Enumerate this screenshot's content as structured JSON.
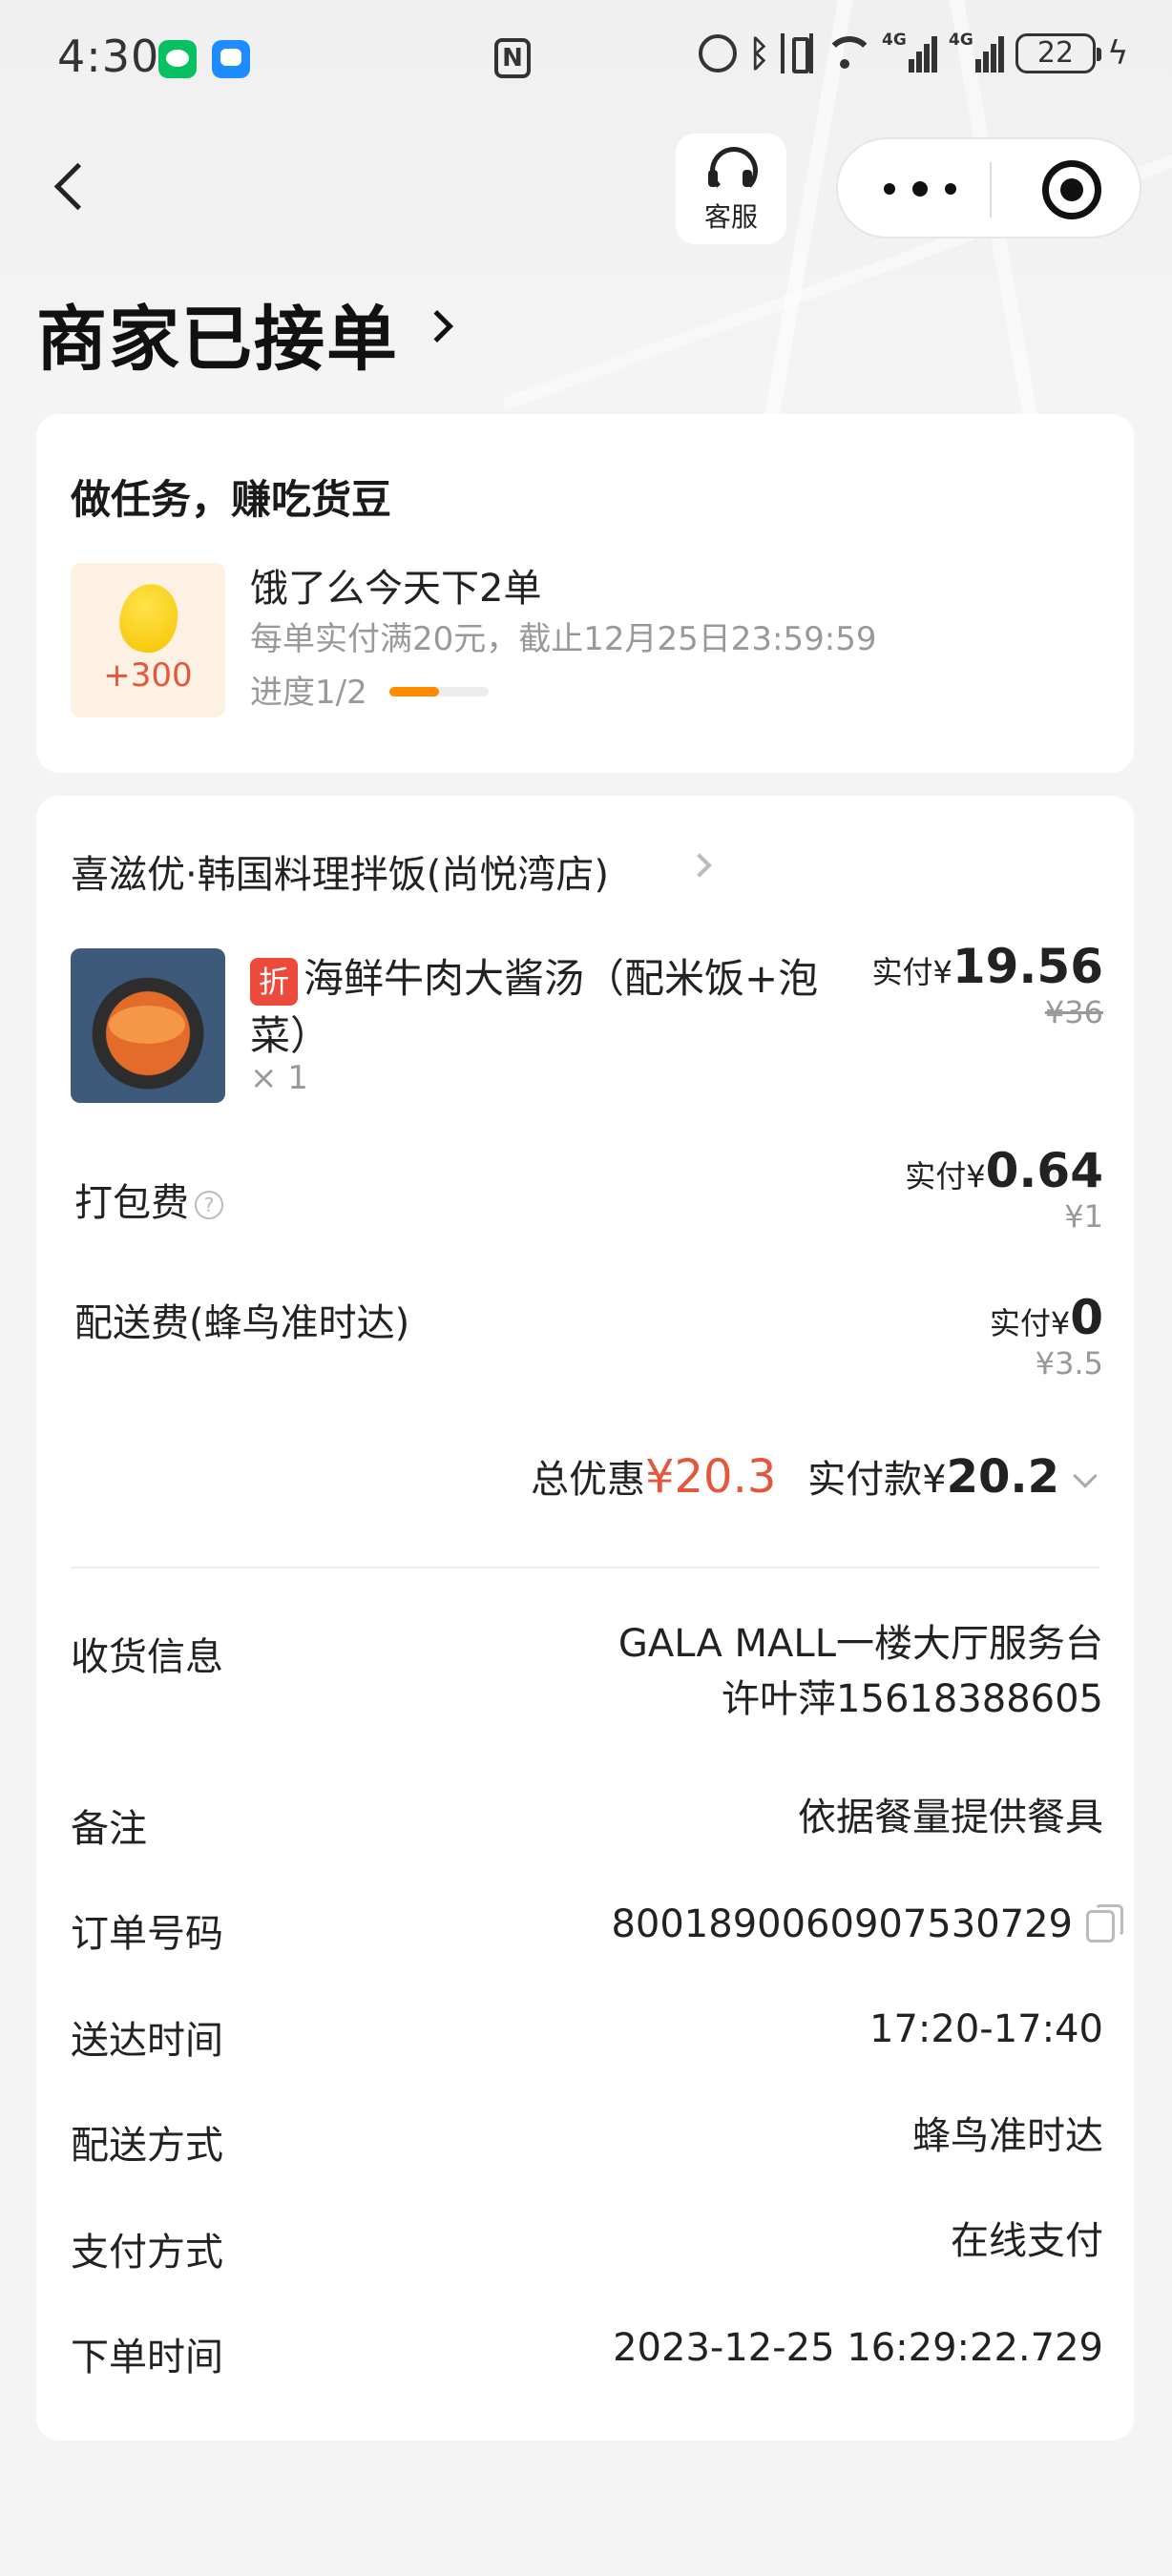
{
  "status_bar": {
    "time": "4:30",
    "battery": "22",
    "signal_label": "4G"
  },
  "header": {
    "service_label": "客服",
    "title": "商家已接单"
  },
  "task": {
    "title": "做任务，赚吃货豆",
    "reward": "+300",
    "name": "饿了么今天下2单",
    "desc": "每单实付满20元，截止12月25日23:59:59",
    "progress_label": "进度1/2",
    "progress_value": 0.5
  },
  "order": {
    "shop_name": "喜滋优·韩国料理拌饭(尚悦湾店)",
    "item": {
      "tag": "折",
      "name": "海鲜牛肉大酱汤（配米饭+泡菜）",
      "qty": "× 1",
      "paid_prefix": "实付¥",
      "paid": "19.56",
      "original": "¥36"
    },
    "packing": {
      "label": "打包费",
      "help_icon": "?",
      "paid_prefix": "实付¥",
      "paid": "0.64",
      "original": "¥1"
    },
    "delivery": {
      "label": "配送费(蜂鸟准时达)",
      "paid_prefix": "实付¥",
      "paid": "0",
      "original": "¥3.5"
    },
    "total": {
      "discount_label": "总优惠",
      "discount": "¥20.3",
      "paid_label": "实付款¥",
      "paid": "20.2"
    },
    "info": [
      {
        "label": "收货信息",
        "value": "GALA MALL一楼大厅服务台",
        "value2": "许叶萍15618388605"
      },
      {
        "label": "备注",
        "value": "依据餐量提供餐具"
      },
      {
        "label": "订单号码",
        "value": "8001890060907530729"
      },
      {
        "label": "送达时间",
        "value": "17:20-17:40"
      },
      {
        "label": "配送方式",
        "value": "蜂鸟准时达"
      },
      {
        "label": "支付方式",
        "value": "在线支付"
      },
      {
        "label": "下单时间",
        "value": "2023-12-25 16:29:22.729"
      }
    ]
  },
  "colors": {
    "accent_red": "#e4573d",
    "progress_orange": "#ff8a00",
    "tag_red": "#ec4a3a"
  }
}
